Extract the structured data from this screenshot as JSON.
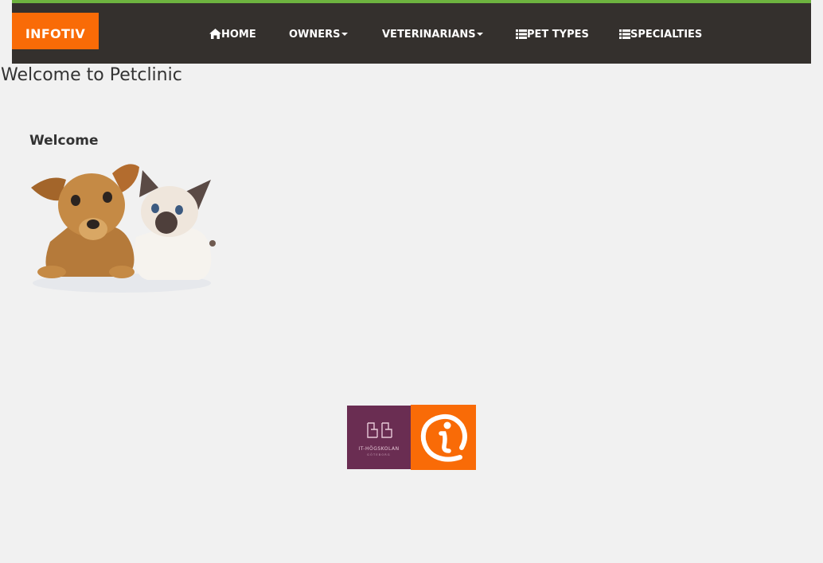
{
  "navbar": {
    "brand": "INFOTIV",
    "items": [
      {
        "label": "HOME",
        "icon": "home-icon"
      },
      {
        "label": "OWNERS",
        "icon": "caret-down-icon"
      },
      {
        "label": "VETERINARIANS",
        "icon": "caret-down-icon"
      },
      {
        "label": "PET TYPES",
        "icon": "list-icon"
      },
      {
        "label": "SPECIALTIES",
        "icon": "list-icon"
      }
    ]
  },
  "main": {
    "title": "Welcome to Petclinic",
    "section_title": "Welcome"
  },
  "footer": {
    "its_logo_text": "IT-HÖGSKOLAN",
    "its_logo_subtext": "GÖTEBORG"
  },
  "colors": {
    "accent_green": "#6db33f",
    "navbar_bg": "#34302d",
    "brand_orange": "#f96b07",
    "its_purple": "#6a2d52",
    "page_bg": "#f1f1f1"
  }
}
